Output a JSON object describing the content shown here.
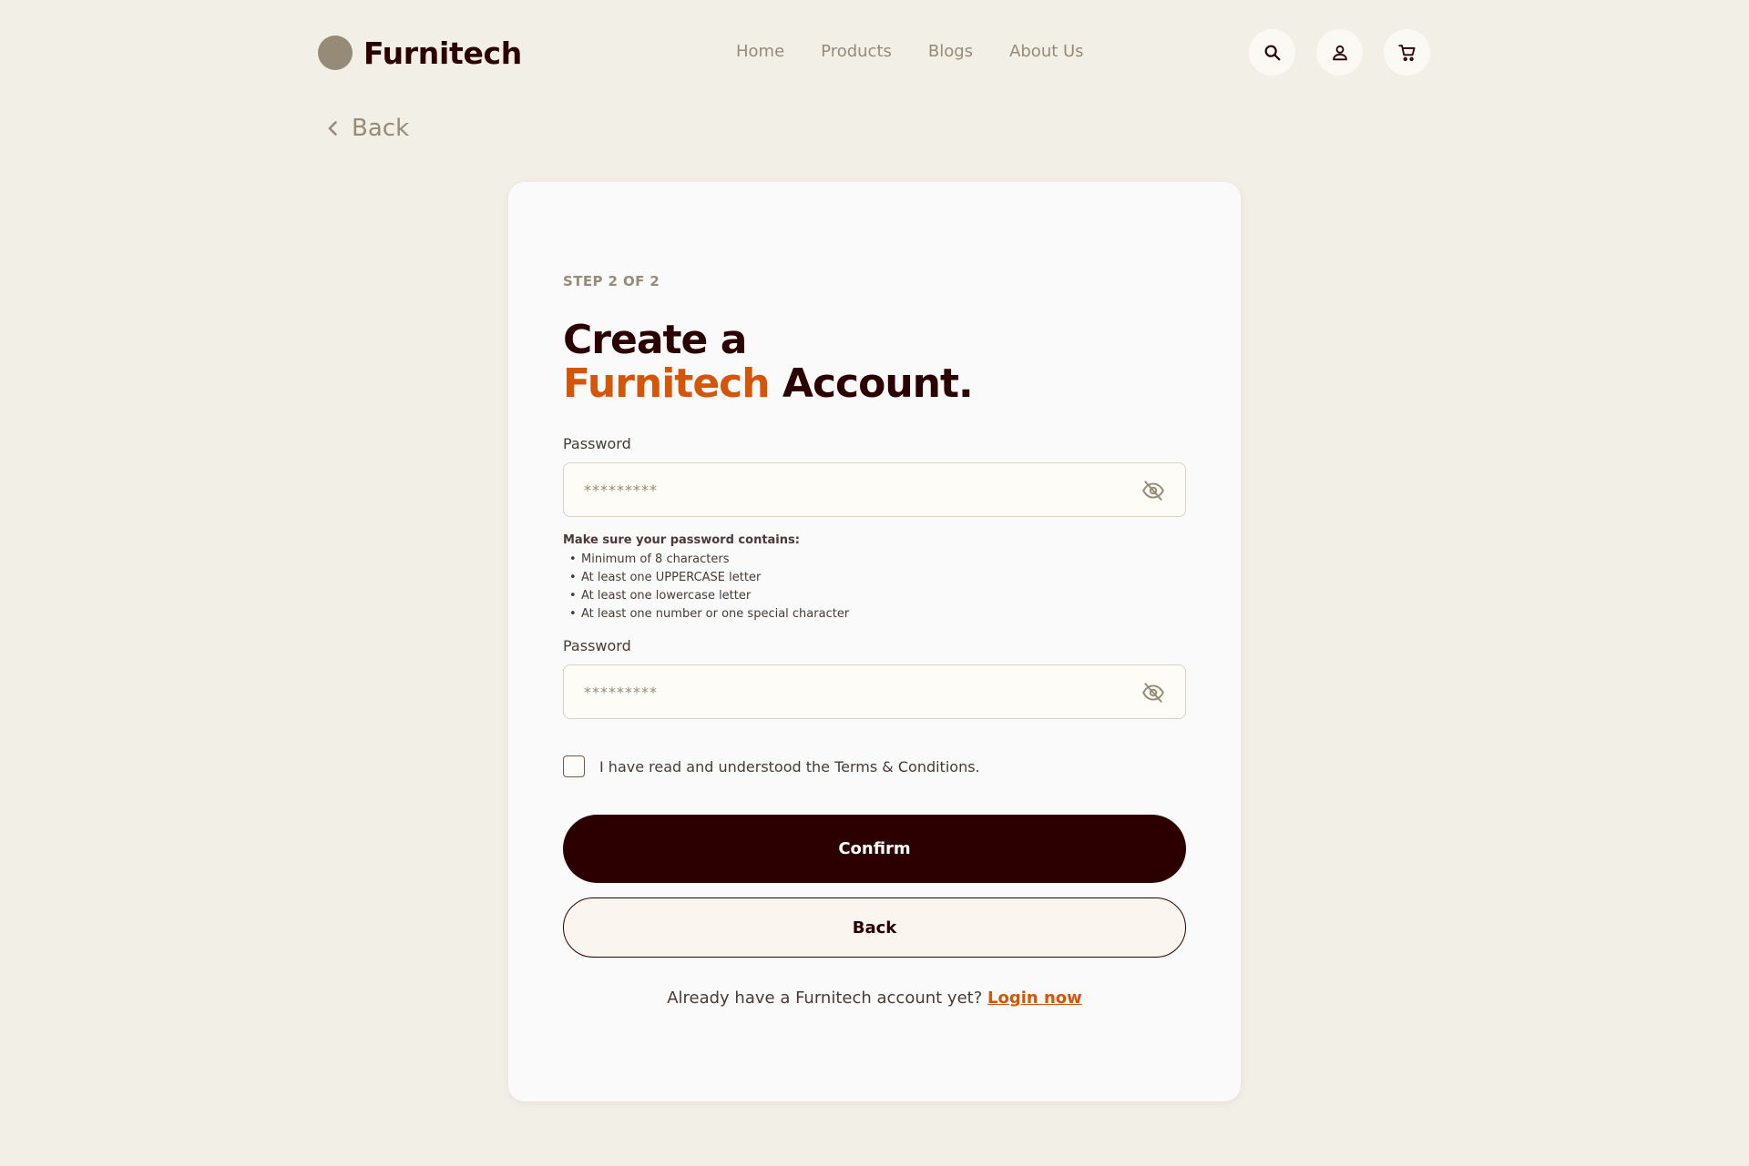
{
  "brand": {
    "name": "Furnitech",
    "logo_color": "#958b77"
  },
  "nav": {
    "links": [
      "Home",
      "Products",
      "Blogs",
      "About Us"
    ],
    "icons": [
      "search-icon",
      "user-icon",
      "cart-icon"
    ]
  },
  "back_link": {
    "label": "Back"
  },
  "form": {
    "step": "STEP 2 OF 2",
    "title_line1": "Create a",
    "title_brand": "Furnitech",
    "title_suffix": " Account.",
    "password_label": "Password",
    "password_placeholder": "*********",
    "hint_title": "Make sure your password contains:",
    "hint_items": [
      "Minimum of 8 characters",
      "At least one UPPERCASE letter",
      "At least one lowercase letter",
      "At least one number or one special character"
    ],
    "confirm_label": "Password",
    "confirm_placeholder": "*********",
    "terms_text": "I have read and understood the Terms & Conditions.",
    "confirm_button": "Confirm",
    "back_button": "Back",
    "login_prompt": "Already have a Furnitech account yet? ",
    "login_link": "Login now"
  },
  "colors": {
    "background": "#f2efe7",
    "card": "#fafafa",
    "primary": "#2d0000",
    "accent": "#d4560a",
    "muted": "#958b77"
  }
}
